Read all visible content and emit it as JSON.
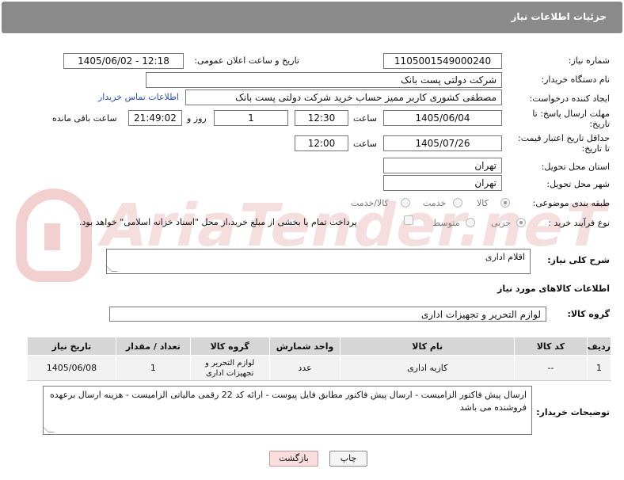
{
  "header": {
    "title": "جزئیات اطلاعات نیاز"
  },
  "watermark": {
    "text": "AriaTender.neT"
  },
  "form": {
    "need_number_label": "شماره نیاز:",
    "need_number_value": "1105001549000240",
    "announce_label": "تاریخ و ساعت اعلان عمومی:",
    "announce_value": "1405/06/02 - 12:18",
    "buyer_org_label": "نام دستگاه خریدار:",
    "buyer_org_value": "شرکت دولتی پست بانک",
    "requester_label": "ایجاد کننده درخواست:",
    "requester_value": "مصطفی کشوری کاربر ممیز حساب خرید شرکت دولتی پست بانک",
    "contact_link": "اطلاعات تماس خریدار",
    "reply_deadline_label_1": "مهلت ارسال پاسخ: تا",
    "reply_deadline_label_2": "تاریخ:",
    "reply_date": "1405/06/04",
    "time_label": "ساعت",
    "reply_time": "12:30",
    "days_value": "1",
    "days_label": "روز و",
    "remaining_time": "21:49:02",
    "remaining_label": "ساعت باقی مانده",
    "price_valid_label_1": "حداقل تاریخ اعتبار قیمت:",
    "price_valid_label_2": "تا تاریخ:",
    "price_valid_date": "1405/07/26",
    "price_valid_time": "12:00",
    "province_label": "استان محل تحویل:",
    "province_value": "تهران",
    "city_label": "شهر محل تحویل:",
    "city_value": "تهران",
    "category_label": "طبقه بندی موضوعی:",
    "category_options": [
      "کالا",
      "خدمت",
      "کالا/خدمت"
    ],
    "category_selected": "کالا",
    "process_label": "نوع فرآیند خرید :",
    "process_options": [
      "جزیی",
      "متوسط"
    ],
    "process_selected": "جزیی",
    "payment_note": "پرداخت تمام یا بخشی از مبلغ خرید،از محل \"اسناد خزانه اسلامی\" خواهد بود."
  },
  "summary": {
    "label": "شرح کلی نیاز:",
    "value": "اقلام اداری"
  },
  "goods_section": {
    "title": "اطلاعات کالاهای مورد نیاز",
    "group_label": "گروه کالا:",
    "group_value": "لوازم التحریر و تجهیزات اداری"
  },
  "table": {
    "headers": [
      "ردیف",
      "کد کالا",
      "نام کالا",
      "واحد شمارش",
      "گروه کالا",
      "تعداد / مقدار",
      "تاریخ نیاز"
    ],
    "rows": [
      [
        "1",
        "--",
        "کازیه اداری",
        "عدد",
        "لوازم التحریر و تجهیزات اداری",
        "1",
        "1405/06/08"
      ]
    ]
  },
  "buyer_notes": {
    "label": "توضیحات خریدار:",
    "value": "ارسال پیش فاکتور الزامیست - ارسال پیش فاکتور مطابق فایل پیوست - ارائه کد 22 رقمی مالیاتی الزامیست - هزینه ارسال برعهده فروشنده می باشد"
  },
  "buttons": {
    "print": "چاپ",
    "back": "بازگشت"
  }
}
